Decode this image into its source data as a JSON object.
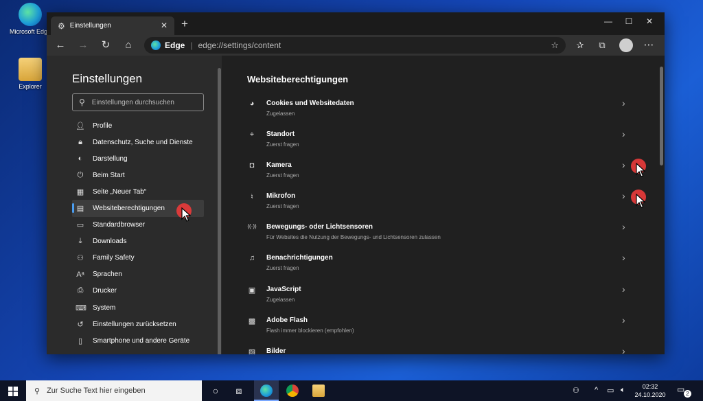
{
  "desktop": {
    "icons": [
      {
        "label": "Microsoft Edge",
        "icon": "edge-icon"
      },
      {
        "label": "Explorer",
        "icon": "folder-icon"
      }
    ]
  },
  "browser": {
    "tab_title": "Einstellungen",
    "address_brand": "Edge",
    "address_url": "edge://settings/content"
  },
  "sidebar": {
    "title": "Einstellungen",
    "search_placeholder": "Einstellungen durchsuchen",
    "active_index": 5,
    "items": [
      {
        "label": "Profile",
        "icon": "profile-icon"
      },
      {
        "label": "Datenschutz, Suche und Dienste",
        "icon": "lock-icon"
      },
      {
        "label": "Darstellung",
        "icon": "palette-icon"
      },
      {
        "label": "Beim Start",
        "icon": "power-icon"
      },
      {
        "label": "Seite „Neuer Tab“",
        "icon": "grid-icon"
      },
      {
        "label": "Websiteberechtigungen",
        "icon": "site-permissions-icon"
      },
      {
        "label": "Standardbrowser",
        "icon": "browser-icon"
      },
      {
        "label": "Downloads",
        "icon": "download-icon"
      },
      {
        "label": "Family Safety",
        "icon": "family-icon"
      },
      {
        "label": "Sprachen",
        "icon": "language-icon"
      },
      {
        "label": "Drucker",
        "icon": "printer-icon"
      },
      {
        "label": "System",
        "icon": "laptop-icon"
      },
      {
        "label": "Einstellungen zurücksetzen",
        "icon": "reset-icon"
      },
      {
        "label": "Smartphone und andere Geräte",
        "icon": "phone-icon"
      }
    ]
  },
  "main": {
    "title": "Websiteberechtigungen",
    "permissions": [
      {
        "title": "Cookies und Websitedaten",
        "status": "Zugelassen",
        "icon": "cookie-icon"
      },
      {
        "title": "Standort",
        "status": "Zuerst fragen",
        "icon": "location-icon"
      },
      {
        "title": "Kamera",
        "status": "Zuerst fragen",
        "icon": "camera-icon"
      },
      {
        "title": "Mikrofon",
        "status": "Zuerst fragen",
        "icon": "microphone-icon"
      },
      {
        "title": "Bewegungs- oder Lichtsensoren",
        "status": "Für Websites die Nutzung der Bewegungs- und Lichtsensoren zulassen",
        "icon": "sensor-icon"
      },
      {
        "title": "Benachrichtigungen",
        "status": "Zuerst fragen",
        "icon": "bell-icon"
      },
      {
        "title": "JavaScript",
        "status": "Zugelassen",
        "icon": "javascript-icon"
      },
      {
        "title": "Adobe Flash",
        "status": "Flash immer blockieren (empfohlen)",
        "icon": "flash-icon"
      },
      {
        "title": "Bilder",
        "status": "",
        "icon": "image-icon"
      }
    ]
  },
  "taskbar": {
    "search_placeholder": "Zur Suche Text hier eingeben",
    "time": "02:32",
    "date": "24.10.2020",
    "notification_count": "2"
  },
  "colors": {
    "accent": "#4a9df0",
    "cursor_marker": "#e23a3a",
    "sidebar_bg": "#2b2b2b",
    "content_bg": "#202020"
  }
}
